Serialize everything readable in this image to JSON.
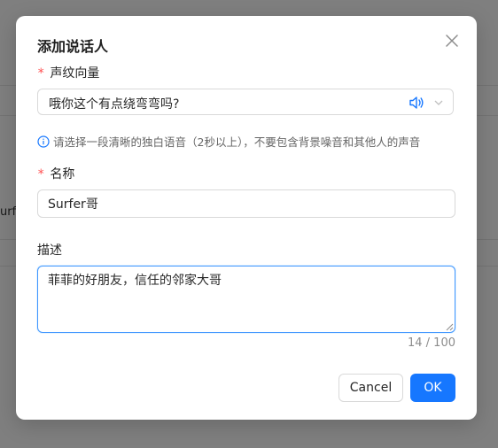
{
  "background": {
    "partial_text": "urfe"
  },
  "dialog": {
    "title": "添加说话人",
    "voice_field": {
      "required_mark": "*",
      "label": "声纹向量",
      "value": "哦你这个有点绕弯弯吗?"
    },
    "hint": "请选择一段清晰的独白语音（2秒以上），不要包含背景噪音和其他人的声音",
    "name_field": {
      "required_mark": "*",
      "label": "名称",
      "value": "Surfer哥"
    },
    "description_field": {
      "label": "描述",
      "value": "菲菲的好朋友，信任的邻家大哥",
      "counter": "14 / 100"
    },
    "buttons": {
      "cancel": "Cancel",
      "ok": "OK"
    }
  },
  "colors": {
    "primary": "#1677ff",
    "required": "#ff4d4f",
    "focus_border": "#4096ff"
  },
  "icons": {
    "close": "close-icon",
    "speaker": "speaker-icon",
    "chevron": "chevron-down-icon",
    "info": "info-icon"
  }
}
